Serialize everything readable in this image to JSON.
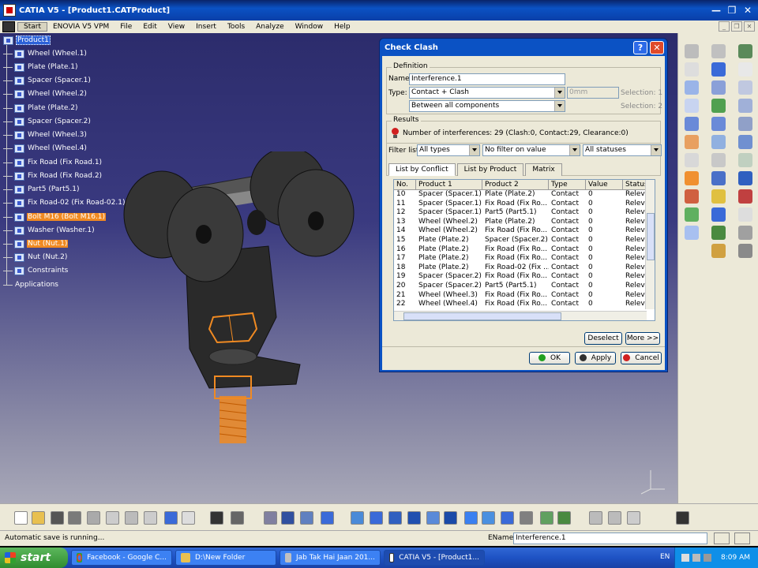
{
  "window": {
    "title": "CATIA V5 - [Product1.CATProduct]"
  },
  "menu": {
    "items": [
      "Start",
      "ENOVIA V5 VPM",
      "File",
      "Edit",
      "View",
      "Insert",
      "Tools",
      "Analyze",
      "Window",
      "Help"
    ]
  },
  "tree": {
    "root": "Product1",
    "items": [
      {
        "label": "Wheel (Wheel.1)"
      },
      {
        "label": "Plate (Plate.1)"
      },
      {
        "label": "Spacer (Spacer.1)"
      },
      {
        "label": "Wheel (Wheel.2)"
      },
      {
        "label": "Plate (Plate.2)"
      },
      {
        "label": "Spacer (Spacer.2)"
      },
      {
        "label": "Wheel (Wheel.3)"
      },
      {
        "label": "Wheel (Wheel.4)"
      },
      {
        "label": "Fix Road (Fix Road.1)"
      },
      {
        "label": "Fix Road (Fix Road.2)"
      },
      {
        "label": "Part5 (Part5.1)"
      },
      {
        "label": "Fix Road-02 (Fix Road-02.1)"
      },
      {
        "label": "Bolt M16 (Bolt M16.1)"
      },
      {
        "label": "Washer (Washer.1)"
      },
      {
        "label": "Nut (Nut.1)"
      },
      {
        "label": "Nut (Nut.2)"
      },
      {
        "label": "Constraints"
      },
      {
        "label": "Applications"
      }
    ]
  },
  "dialog": {
    "title": "Check Clash",
    "definition_label": "Definition",
    "name_label": "Name:",
    "name_value": "Interference.1",
    "type_label": "Type:",
    "type_value": "Contact + Clash",
    "clearance_value": "0mm",
    "scope_value": "Between all components",
    "selection1": "Selection: 1",
    "selection2": "Selection: 2",
    "results_label": "Results",
    "results_text": "Number of interferences: 29 (Clash:0, Contact:29, Clearance:0)",
    "filter_label": "Filter list:",
    "filter_types": "All types",
    "filter_value": "No filter on value",
    "filter_status": "All statuses",
    "tabs": [
      "List by Conflict",
      "List by Product",
      "Matrix"
    ],
    "columns": [
      "No.",
      "Product 1",
      "Product 2",
      "Type",
      "Value",
      "Status"
    ],
    "rows": [
      [
        "10",
        "Spacer (Spacer.1)",
        "Plate (Plate.2)",
        "Contact",
        "0",
        "Relev"
      ],
      [
        "11",
        "Spacer (Spacer.1)",
        "Fix Road (Fix Ro...",
        "Contact",
        "0",
        "Relev"
      ],
      [
        "12",
        "Spacer (Spacer.1)",
        "Part5 (Part5.1)",
        "Contact",
        "0",
        "Relev"
      ],
      [
        "13",
        "Wheel (Wheel.2)",
        "Plate (Plate.2)",
        "Contact",
        "0",
        "Relev"
      ],
      [
        "14",
        "Wheel (Wheel.2)",
        "Fix Road (Fix Ro...",
        "Contact",
        "0",
        "Relev"
      ],
      [
        "15",
        "Plate (Plate.2)",
        "Spacer (Spacer.2)",
        "Contact",
        "0",
        "Relev"
      ],
      [
        "16",
        "Plate (Plate.2)",
        "Fix Road (Fix Ro...",
        "Contact",
        "0",
        "Relev"
      ],
      [
        "17",
        "Plate (Plate.2)",
        "Fix Road (Fix Ro...",
        "Contact",
        "0",
        "Relev"
      ],
      [
        "18",
        "Plate (Plate.2)",
        "Fix Road-02 (Fix ...",
        "Contact",
        "0",
        "Relev"
      ],
      [
        "19",
        "Spacer (Spacer.2)",
        "Fix Road (Fix Ro...",
        "Contact",
        "0",
        "Relev"
      ],
      [
        "20",
        "Spacer (Spacer.2)",
        "Part5 (Part5.1)",
        "Contact",
        "0",
        "Relev"
      ],
      [
        "21",
        "Wheel (Wheel.3)",
        "Fix Road (Fix Ro...",
        "Contact",
        "0",
        "Relev"
      ],
      [
        "22",
        "Wheel (Wheel.4)",
        "Fix Road (Fix Ro...",
        "Contact",
        "0",
        "Relev"
      ]
    ],
    "deselect_label": "Deselect",
    "more_label": "More >>",
    "ok_label": "OK",
    "apply_label": "Apply",
    "cancel_label": "Cancel"
  },
  "status": {
    "message": "Automatic save is running...",
    "ename_label": "EName",
    "ename_value": "Interference.1"
  },
  "taskbar": {
    "start_label": "start",
    "tasks": [
      "Facebook - Google C...",
      "D:\\New Folder",
      "Jab Tak Hai Jaan 201...",
      "CATIA V5 - [Product1..."
    ],
    "lang": "EN",
    "clock": "8:09 AM"
  },
  "colors": {
    "highlight": "#f08a22",
    "selection": "#2c62d8",
    "title_blue": "#0b52c4"
  },
  "icons": {
    "compass": "compass-icon",
    "axis": "axis-icon"
  }
}
